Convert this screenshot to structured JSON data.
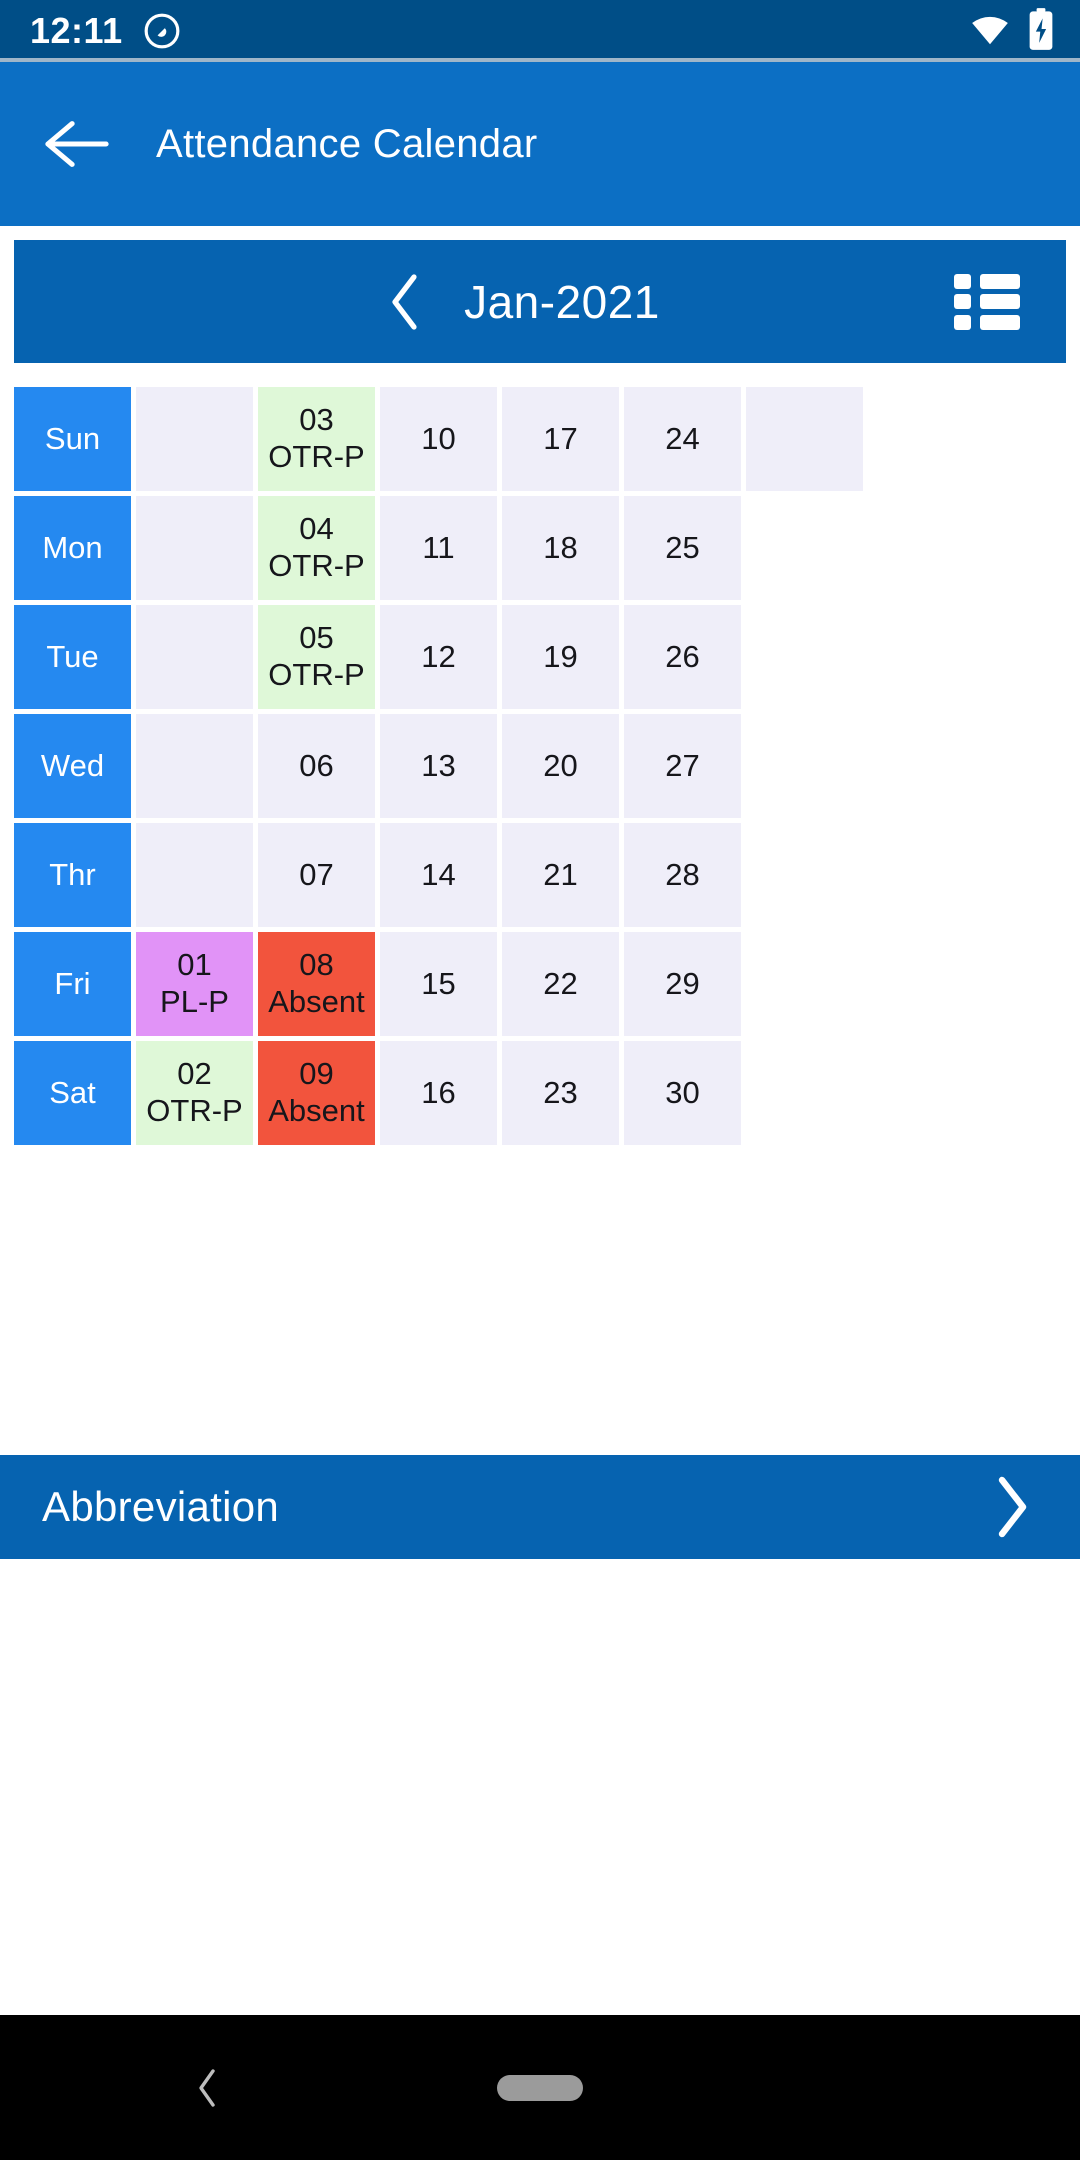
{
  "status_bar": {
    "time": "12:11",
    "notification_icon": "circle-arrow-icon",
    "wifi_icon": "wifi-icon",
    "battery_icon": "battery-charging-icon",
    "background_color": "#004E87"
  },
  "app_bar": {
    "back_icon": "back-arrow-icon",
    "title": "Attendance Calendar",
    "background_color": "#0C6FC4"
  },
  "month_header": {
    "prev_icon": "chevron-left-icon",
    "label": "Jan-2021",
    "list_view_icon": "list-view-icon",
    "background_color": "#0663B0"
  },
  "legend_colors": {
    "day_label": "#2589F0",
    "empty": "#EFEEF9",
    "normal": "#EFEEF9",
    "otr_p": "#DFF8D8",
    "pl_p": "#E193F7",
    "absent": "#F2543D"
  },
  "calendar": {
    "weekday_labels": [
      "Sun",
      "Mon",
      "Tue",
      "Wed",
      "Thr",
      "Fri",
      "Sat"
    ],
    "rows": [
      {
        "day": "Sun",
        "cells": [
          {
            "num": "",
            "tag": "",
            "state": "empty"
          },
          {
            "num": "03",
            "tag": "OTR-P",
            "state": "otr"
          },
          {
            "num": "10",
            "tag": "",
            "state": "normal"
          },
          {
            "num": "17",
            "tag": "",
            "state": "normal"
          },
          {
            "num": "24",
            "tag": "",
            "state": "normal"
          },
          {
            "num": "",
            "tag": "",
            "state": "normal"
          }
        ]
      },
      {
        "day": "Mon",
        "cells": [
          {
            "num": "",
            "tag": "",
            "state": "empty"
          },
          {
            "num": "04",
            "tag": "OTR-P",
            "state": "otr"
          },
          {
            "num": "11",
            "tag": "",
            "state": "normal"
          },
          {
            "num": "18",
            "tag": "",
            "state": "normal"
          },
          {
            "num": "25",
            "tag": "",
            "state": "normal"
          },
          {
            "num": "",
            "tag": "",
            "state": "blank"
          }
        ]
      },
      {
        "day": "Tue",
        "cells": [
          {
            "num": "",
            "tag": "",
            "state": "empty"
          },
          {
            "num": "05",
            "tag": "OTR-P",
            "state": "otr"
          },
          {
            "num": "12",
            "tag": "",
            "state": "normal"
          },
          {
            "num": "19",
            "tag": "",
            "state": "normal"
          },
          {
            "num": "26",
            "tag": "",
            "state": "normal"
          },
          {
            "num": "",
            "tag": "",
            "state": "blank"
          }
        ]
      },
      {
        "day": "Wed",
        "cells": [
          {
            "num": "",
            "tag": "",
            "state": "empty"
          },
          {
            "num": "06",
            "tag": "",
            "state": "normal"
          },
          {
            "num": "13",
            "tag": "",
            "state": "normal"
          },
          {
            "num": "20",
            "tag": "",
            "state": "normal"
          },
          {
            "num": "27",
            "tag": "",
            "state": "normal"
          },
          {
            "num": "",
            "tag": "",
            "state": "blank"
          }
        ]
      },
      {
        "day": "Thr",
        "cells": [
          {
            "num": "",
            "tag": "",
            "state": "empty"
          },
          {
            "num": "07",
            "tag": "",
            "state": "normal"
          },
          {
            "num": "14",
            "tag": "",
            "state": "normal"
          },
          {
            "num": "21",
            "tag": "",
            "state": "normal"
          },
          {
            "num": "28",
            "tag": "",
            "state": "normal"
          },
          {
            "num": "",
            "tag": "",
            "state": "blank"
          }
        ]
      },
      {
        "day": "Fri",
        "cells": [
          {
            "num": "01",
            "tag": "PL-P",
            "state": "pl"
          },
          {
            "num": "08",
            "tag": "Absent",
            "state": "absent"
          },
          {
            "num": "15",
            "tag": "",
            "state": "normal"
          },
          {
            "num": "22",
            "tag": "",
            "state": "normal"
          },
          {
            "num": "29",
            "tag": "",
            "state": "normal"
          },
          {
            "num": "",
            "tag": "",
            "state": "blank"
          }
        ]
      },
      {
        "day": "Sat",
        "cells": [
          {
            "num": "02",
            "tag": "OTR-P",
            "state": "otr"
          },
          {
            "num": "09",
            "tag": "Absent",
            "state": "absent"
          },
          {
            "num": "16",
            "tag": "",
            "state": "normal"
          },
          {
            "num": "23",
            "tag": "",
            "state": "normal"
          },
          {
            "num": "30",
            "tag": "",
            "state": "normal"
          },
          {
            "num": "",
            "tag": "",
            "state": "blank"
          }
        ]
      }
    ]
  },
  "abbreviation_bar": {
    "label": "Abbreviation",
    "chevron_icon": "chevron-right-icon",
    "background_color": "#0663B0"
  },
  "nav_bar": {
    "back_icon": "nav-back-icon",
    "home_pill_icon": "home-pill-icon"
  }
}
